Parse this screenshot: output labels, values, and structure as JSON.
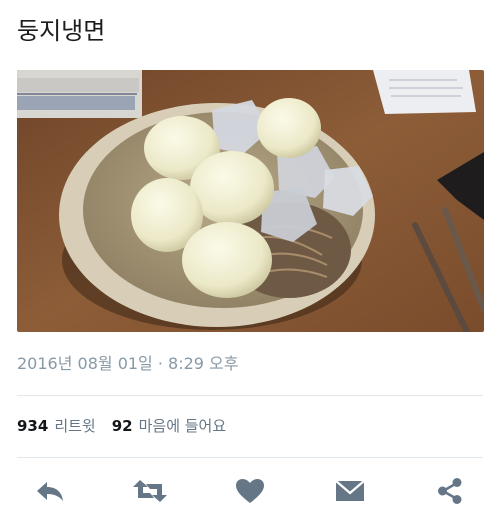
{
  "tweet": {
    "text": "둥지냉면",
    "timestamp": "2016년 08월 01일 · 8:29 오후"
  },
  "stats": {
    "retweets_count": "934",
    "retweets_label": "리트윗",
    "likes_count": "92",
    "likes_label": "마음에 들어요"
  },
  "actions": [
    "reply-icon",
    "retweet-icon",
    "heart-icon",
    "message-icon",
    "share-icon"
  ],
  "colors": {
    "icon": "#657786",
    "muted": "#8899a6",
    "divider": "#e1e8ed",
    "table_wood": "#8a5a34"
  }
}
